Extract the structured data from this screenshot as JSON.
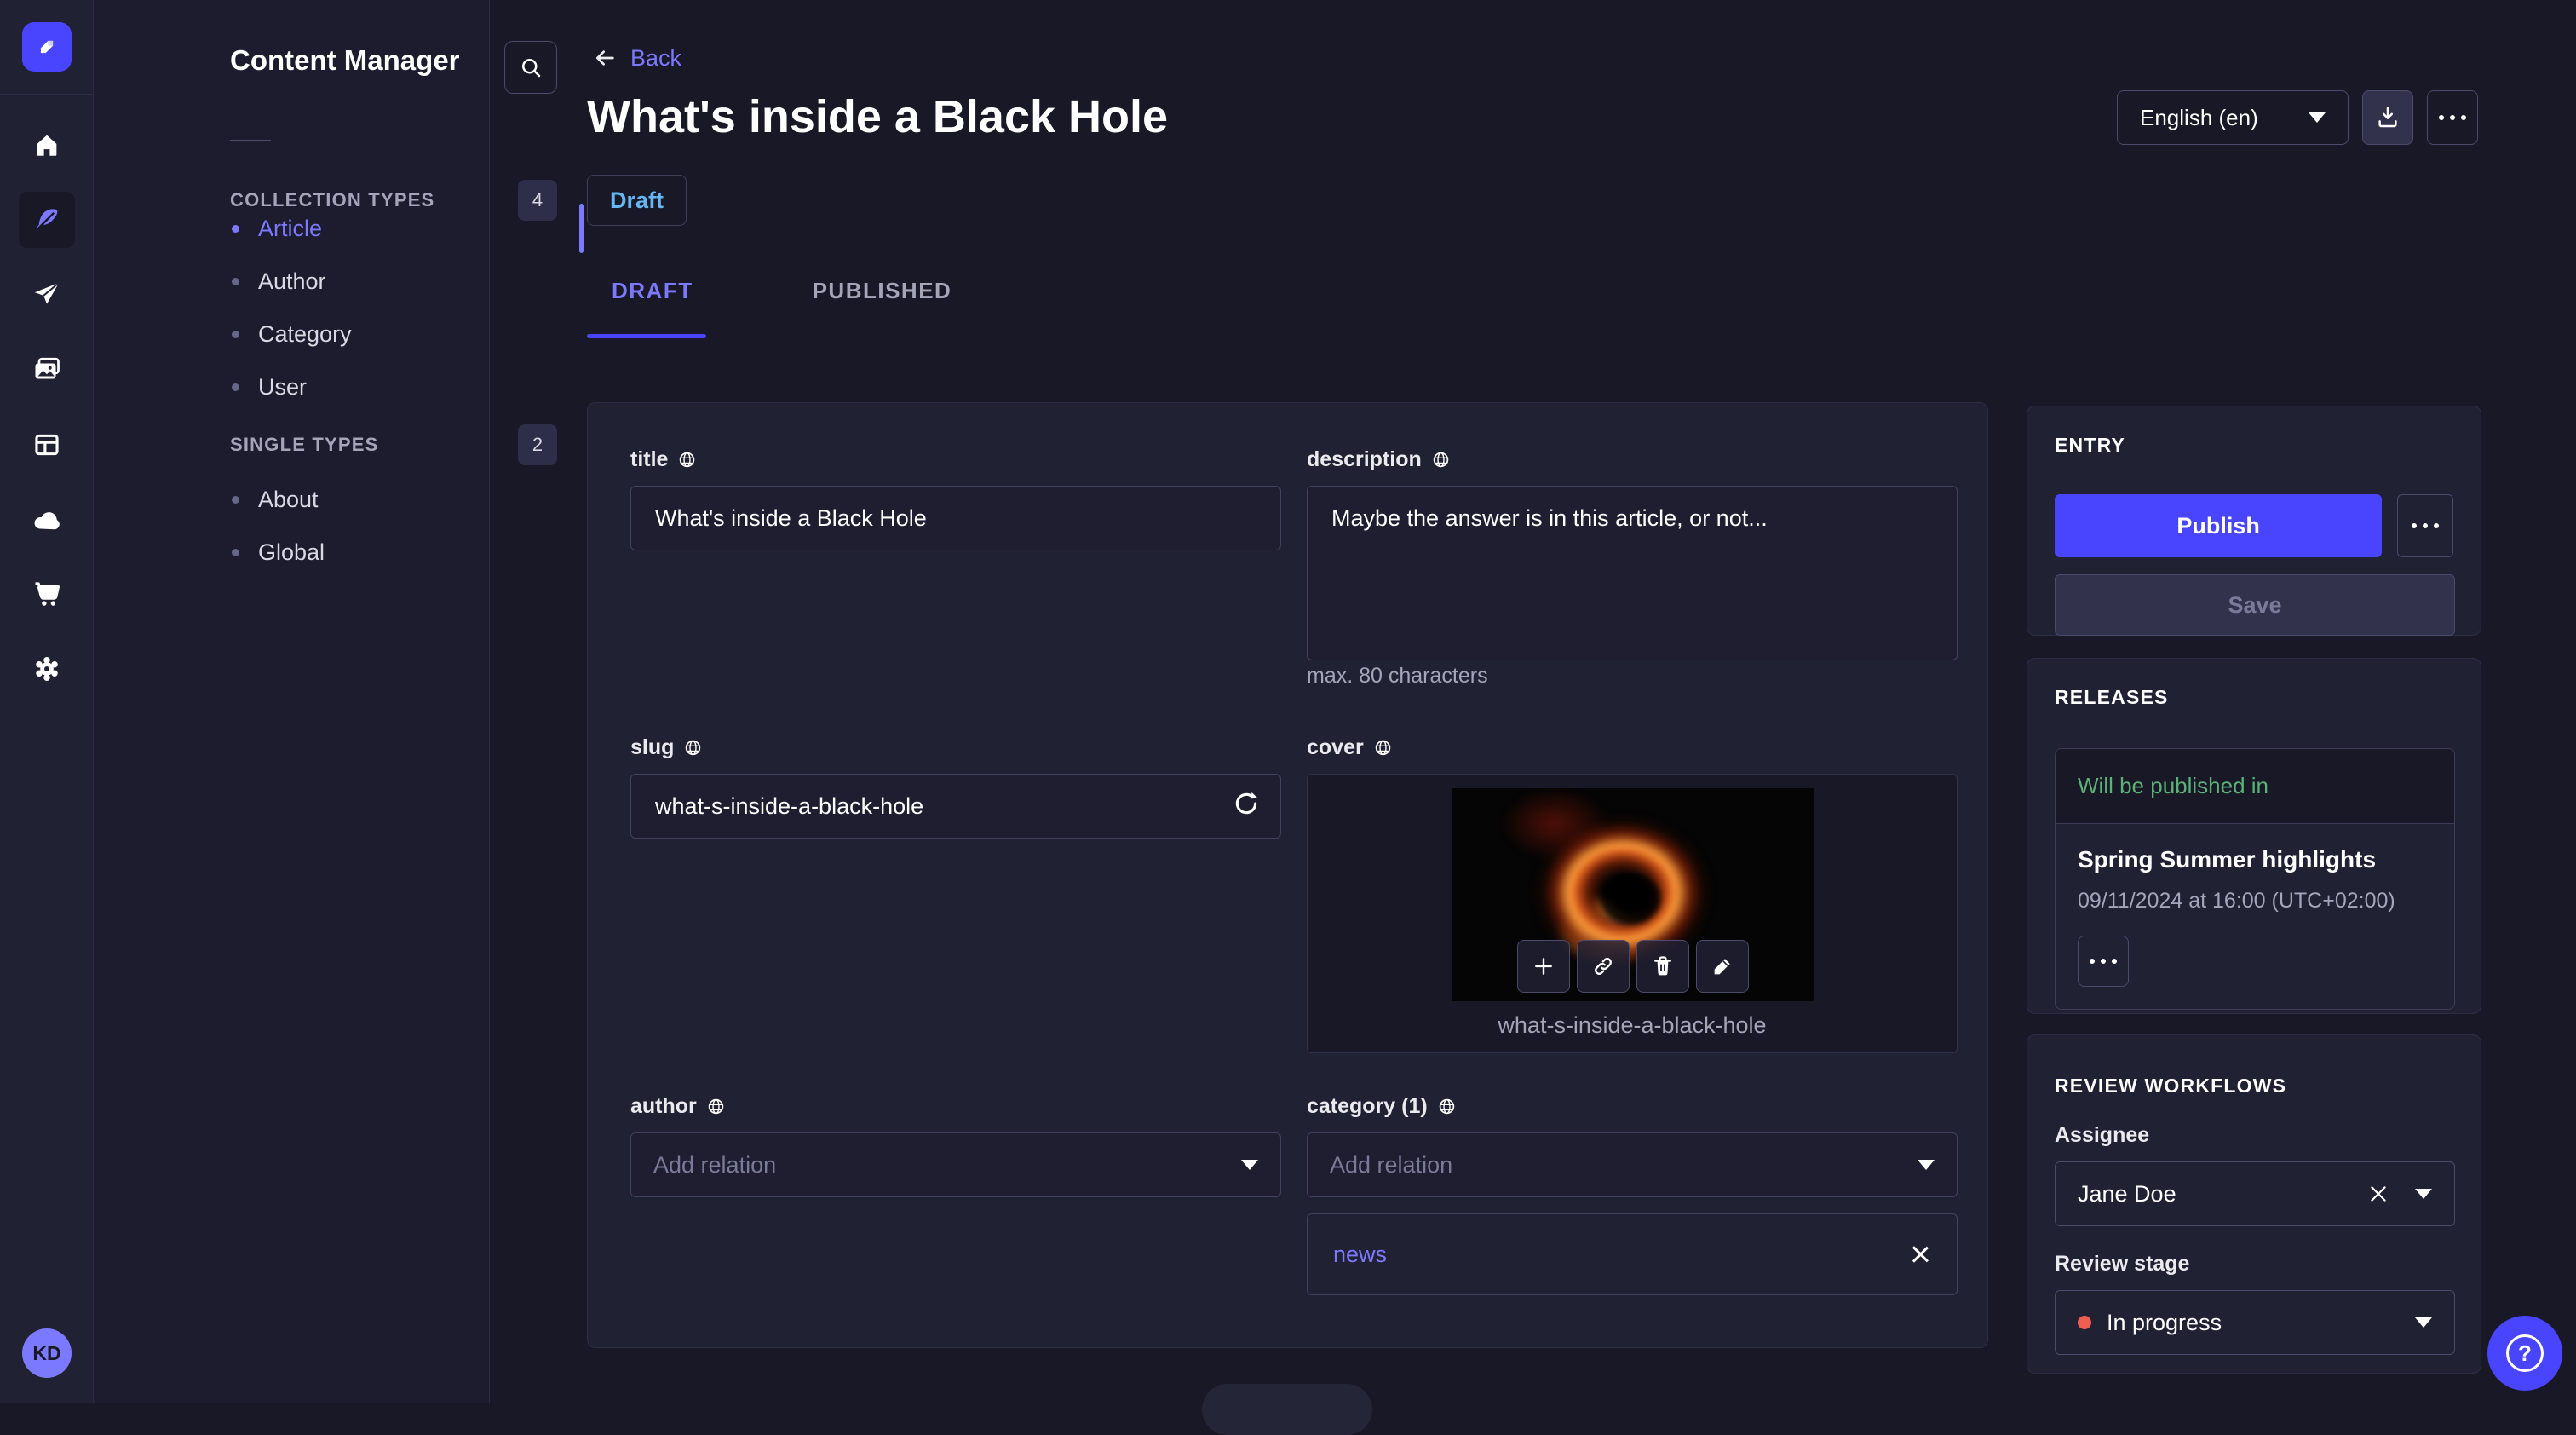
{
  "nav": {
    "icons": [
      "strapi-logo",
      "home",
      "content-manager",
      "release",
      "media-library",
      "content-type-builder",
      "deploy",
      "marketplace",
      "settings"
    ],
    "avatar_initials": "KD"
  },
  "subnav": {
    "title": "Content Manager",
    "sections": [
      {
        "label": "COLLECTION TYPES",
        "count": "4",
        "items": [
          {
            "label": "Article"
          },
          {
            "label": "Author"
          },
          {
            "label": "Category"
          },
          {
            "label": "User"
          }
        ]
      },
      {
        "label": "SINGLE TYPES",
        "count": "2",
        "items": [
          {
            "label": "About"
          },
          {
            "label": "Global"
          }
        ]
      }
    ]
  },
  "header": {
    "back": "Back",
    "title": "What's inside a Black Hole",
    "status": "Draft",
    "tabs": [
      {
        "label": "DRAFT"
      },
      {
        "label": "PUBLISHED"
      }
    ],
    "locale": "English (en)"
  },
  "form": {
    "title": {
      "label": "title",
      "value": "What's inside a Black Hole"
    },
    "description": {
      "label": "description",
      "value": "Maybe the answer is in this article, or not...",
      "hint": "max. 80 characters"
    },
    "slug": {
      "label": "slug",
      "value": "what-s-inside-a-black-hole"
    },
    "cover": {
      "label": "cover",
      "caption": "what-s-inside-a-black-hole"
    },
    "author": {
      "label": "author",
      "placeholder": "Add relation"
    },
    "category": {
      "label": "category (1)",
      "placeholder": "Add relation",
      "tag": "news"
    }
  },
  "entry": {
    "heading": "ENTRY",
    "publish": "Publish",
    "save": "Save"
  },
  "releases": {
    "heading": "RELEASES",
    "banner": "Will be published in",
    "release_name": "Spring Summer highlights",
    "release_date": "09/11/2024 at 16:00 (UTC+02:00)"
  },
  "review": {
    "heading": "REVIEW WORKFLOWS",
    "assignee_label": "Assignee",
    "assignee_value": "Jane Doe",
    "stage_label": "Review stage",
    "stage_value": "In progress"
  },
  "help": {
    "glyph": "?"
  },
  "colors": {
    "primary": "#4945ff",
    "primary_light": "#7b79ff",
    "draft_blue": "#66b7f1",
    "success_green": "#5cb176",
    "danger_red": "#ee5e52",
    "page_bg": "#181826",
    "card_bg": "#212134"
  }
}
